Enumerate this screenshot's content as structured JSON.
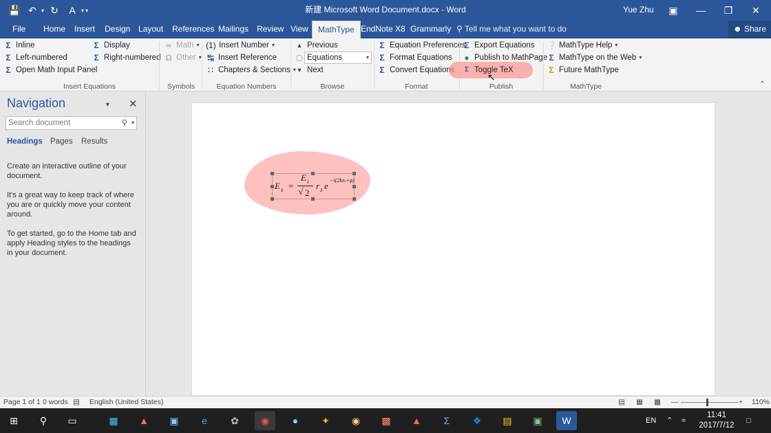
{
  "window": {
    "title": "新建 Microsoft Word Document.docx  -  Word",
    "user": "Yue Zhu"
  },
  "tabs": [
    "File",
    "Home",
    "Insert",
    "Design",
    "Layout",
    "References",
    "Mailings",
    "Review",
    "View",
    "MathType",
    "EndNote X8",
    "Grammarly"
  ],
  "tell_me": "Tell me what you want to do",
  "share_label": "Share",
  "ribbon": {
    "insert_equations": {
      "label": "Insert Equations",
      "inline": "Inline",
      "display": "Display",
      "left_numbered": "Left-numbered",
      "right_numbered": "Right-numbered",
      "open_math_input_panel": "Open Math Input Panel"
    },
    "symbols": {
      "label": "Symbols",
      "math": "Math",
      "other": "Other"
    },
    "equation_numbers": {
      "label": "Equation Numbers",
      "insert_number": "Insert Number",
      "insert_reference": "Insert Reference",
      "chapters_sections": "Chapters & Sections"
    },
    "browse": {
      "label": "Browse",
      "previous": "Previous",
      "selected": "Equations",
      "next": "Next"
    },
    "format": {
      "label": "Format",
      "equation_preferences": "Equation Preferences",
      "format_equations": "Format Equations",
      "convert_equations": "Convert Equations"
    },
    "publish": {
      "label": "Publish",
      "export_equations": "Export Equations",
      "publish_to_mathpage": "Publish to MathPage",
      "toggle_tex": "Toggle TeX"
    },
    "mathtype": {
      "label": "MathType",
      "help": "MathType Help",
      "on_the_web": "MathType on the Web",
      "future": "Future MathType"
    }
  },
  "navigation": {
    "title": "Navigation",
    "search_placeholder": "Search document",
    "tabs": [
      "Headings",
      "Pages",
      "Results"
    ],
    "messages": [
      "Create an interactive outline of your document.",
      "It's a great way to keep track of where you are or quickly move your content around.",
      "To get started, go to the Home tab and apply Heading styles to the headings in your document."
    ]
  },
  "equation": {
    "lhs": "E",
    "lhs_sub": "s",
    "num": "E",
    "num_sub": "i",
    "den": "2",
    "r": "r",
    "r_sub": "s",
    "e": "e",
    "exp": "−i(2kz",
    "exp_sub": "s",
    "exp_tail": "+φ)"
  },
  "status": {
    "page": "Page 1 of 1",
    "words": "0 words",
    "language": "English (United States)",
    "zoom": "110%"
  },
  "taskbar": {
    "lang": "EN",
    "time": "11:41",
    "date": "2017/7/12"
  }
}
